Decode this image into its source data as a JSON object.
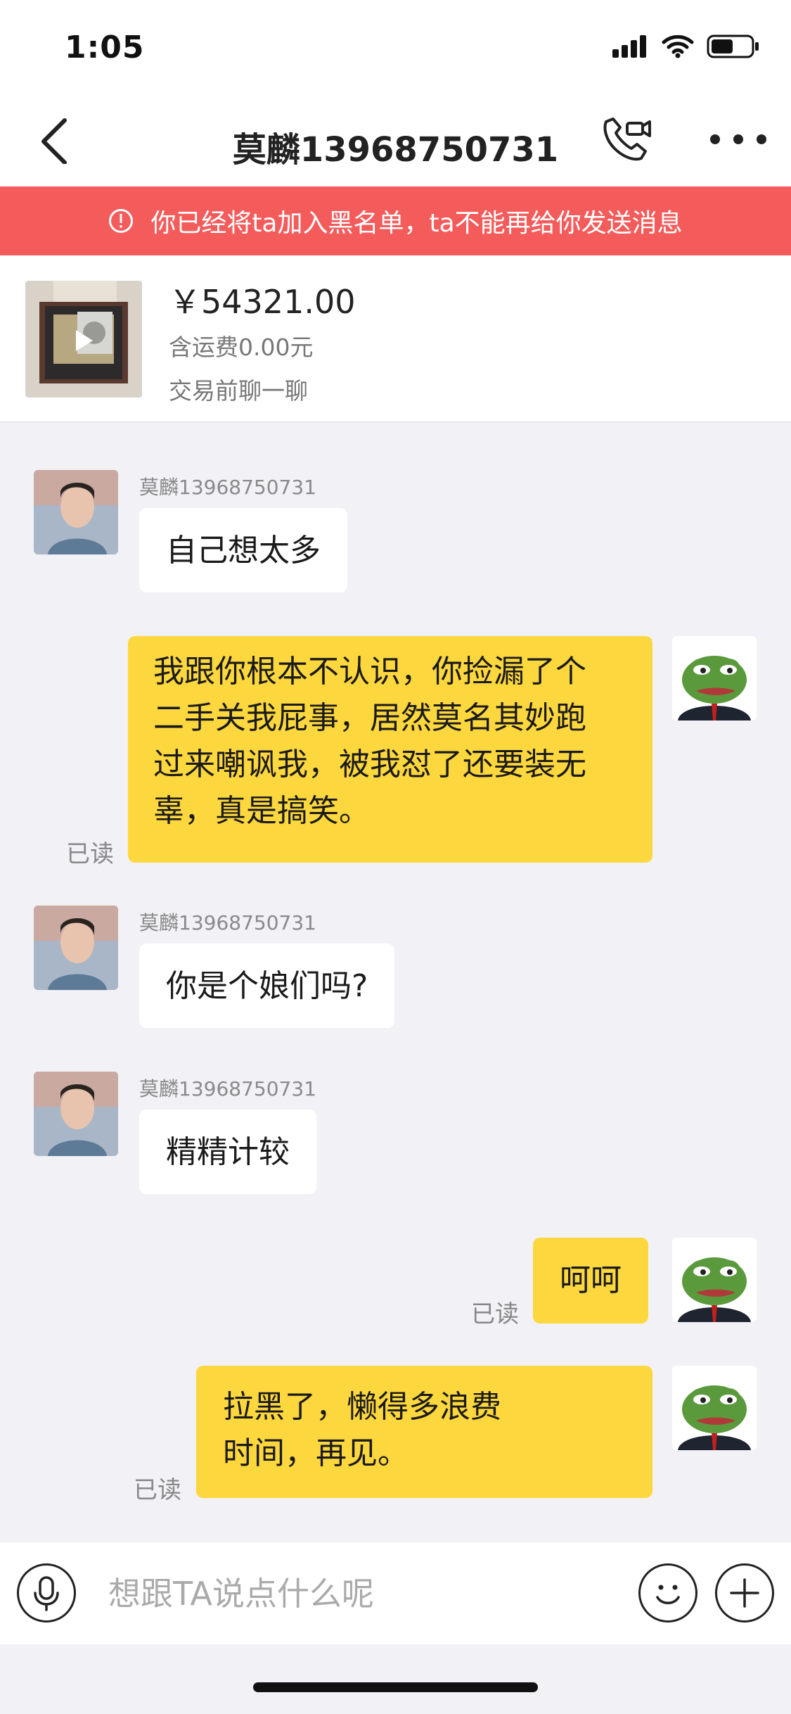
{
  "status_bar": {
    "time": "1:05",
    "battery_level": 0.55
  },
  "nav": {
    "title": "莫麟13968750731",
    "icons": [
      "back-icon",
      "video-call-icon",
      "more-icon"
    ]
  },
  "banner": {
    "text": "你已经将ta加入黑名单，ta不能再给你发送消息",
    "color": "#f45c5c"
  },
  "product": {
    "price": "￥54321.00",
    "shipping": "含运费0.00元",
    "hint": "交易前聊一聊"
  },
  "messages": [
    {
      "from": "other",
      "sender": "莫麟13968750731",
      "text": "自己想太多"
    },
    {
      "from": "self",
      "read": "已读",
      "lines": [
        "我跟你根本不认识，你捡漏了个",
        "二手关我屁事，居然莫名其妙跑",
        "过来嘲讽我，被我怼了还要装无",
        "辜，真是搞笑。"
      ]
    },
    {
      "from": "other",
      "sender": "莫麟13968750731",
      "text": "你是个娘们吗?"
    },
    {
      "from": "other",
      "sender": "莫麟13968750731",
      "text": "精精计较"
    },
    {
      "from": "self",
      "read": "已读",
      "text": "呵呵"
    },
    {
      "from": "self",
      "read": "已读",
      "lines": [
        "拉黑了，懒得多浪费",
        "时间，再见。"
      ]
    }
  ],
  "input": {
    "placeholder": "想跟TA说点什么呢"
  },
  "colors": {
    "accent": "#fdd73e",
    "warning": "#f45c5c",
    "background": "#f1f1f6"
  }
}
